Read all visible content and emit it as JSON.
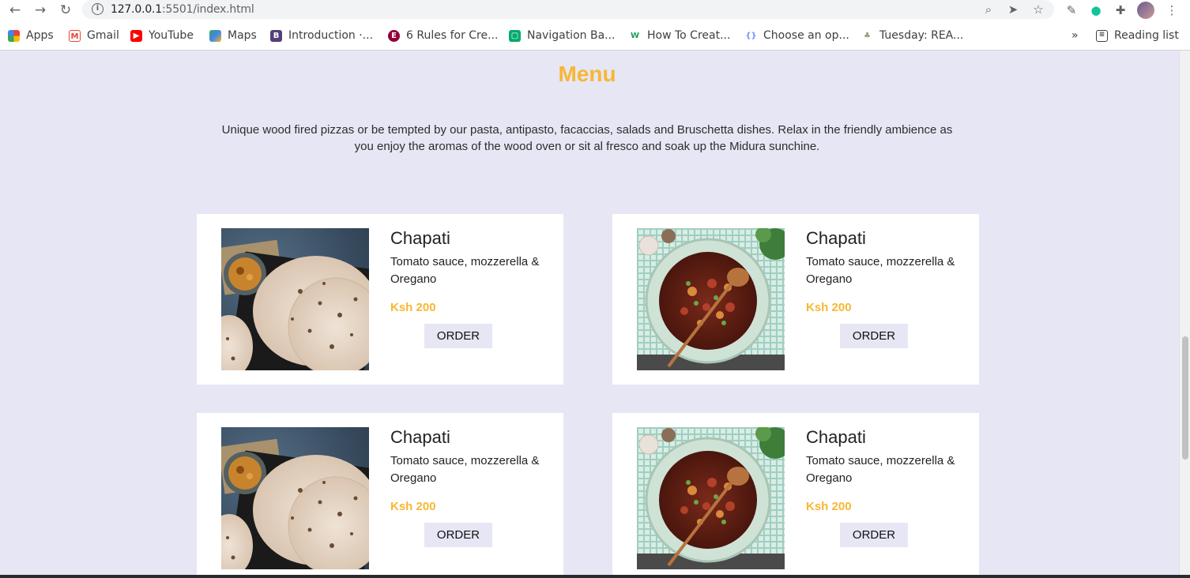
{
  "browser": {
    "url_host": "127.0.0.1",
    "url_rest": ":5501/index.html",
    "bookmarks": [
      {
        "label": "Apps",
        "color": "#4285f4"
      },
      {
        "label": "Gmail",
        "color": "#ea4335"
      },
      {
        "label": "YouTube",
        "color": "#ff0000"
      },
      {
        "label": "Maps",
        "color": "#34a853"
      },
      {
        "label": "Introduction ·...",
        "color": "#563d7c"
      },
      {
        "label": "6 Rules for Cre...",
        "color": "#92003b"
      },
      {
        "label": "Navigation Ba...",
        "color": "#04aa6d"
      },
      {
        "label": "How To Creat...",
        "color": "#1d9c5a"
      },
      {
        "label": "Choose an op...",
        "color": "#7b8cff"
      },
      {
        "label": "Tuesday: REA...",
        "color": "#9aa07a"
      }
    ],
    "overflow_label": "»",
    "reading_list_label": "Reading list"
  },
  "menu": {
    "title": "Menu",
    "description": "Unique wood fired pizzas or be tempted by our pasta, antipasto, facaccias, salads and Bruschetta dishes. Relax in the friendly ambience as you enjoy the aromas of the wood oven or sit al fresco and soak up the Midura sunchine.",
    "items": [
      {
        "name": "Chapati",
        "description": "Tomato sauce, mozzerella & Oregano",
        "price": "Ksh 200",
        "button": "ORDER",
        "image": "chapati"
      },
      {
        "name": "Chapati",
        "description": "Tomato sauce, mozzerella & Oregano",
        "price": "Ksh 200",
        "button": "ORDER",
        "image": "stew"
      },
      {
        "name": "Chapati",
        "description": "Tomato sauce, mozzerella & Oregano",
        "price": "Ksh 200",
        "button": "ORDER",
        "image": "chapati"
      },
      {
        "name": "Chapati",
        "description": "Tomato sauce, mozzerella & Oregano",
        "price": "Ksh 200",
        "button": "ORDER",
        "image": "stew"
      }
    ]
  },
  "colors": {
    "accent": "#f7b733",
    "background": "#e6e6f5",
    "card": "#ffffff"
  }
}
